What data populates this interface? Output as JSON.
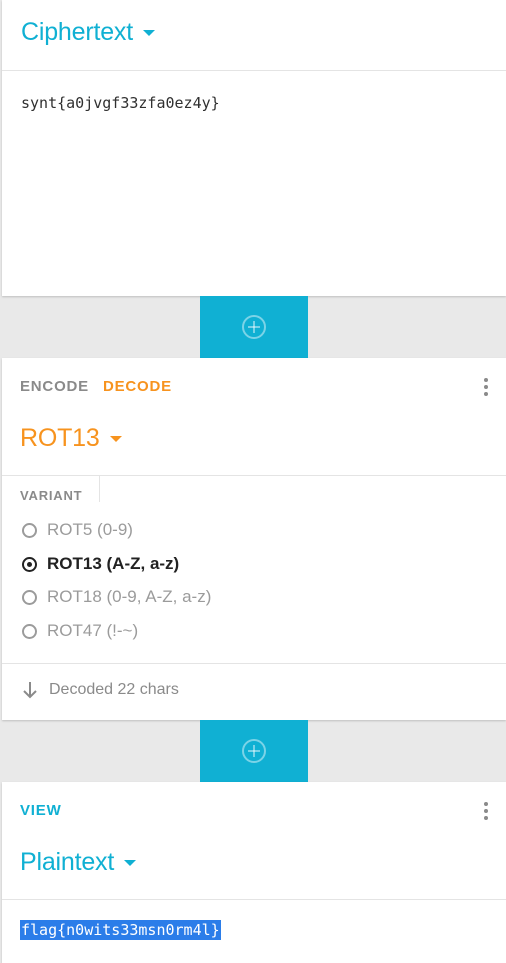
{
  "input": {
    "title": "Ciphertext",
    "value": "synt{a0jvgf33zfa0ez4y}"
  },
  "operation": {
    "tabs": [
      "ENCODE",
      "DECODE"
    ],
    "active_tab": "DECODE",
    "name": "ROT13",
    "variant_label": "VARIANT",
    "variants": [
      {
        "label": "ROT5 (0-9)",
        "checked": false
      },
      {
        "label": "ROT13 (A-Z, a-z)",
        "checked": true
      },
      {
        "label": "ROT18 (0-9, A-Z, a-z)",
        "checked": false
      },
      {
        "label": "ROT47 (!-~)",
        "checked": false
      }
    ],
    "status": "Decoded 22 chars"
  },
  "output": {
    "section_label": "VIEW",
    "title": "Plaintext",
    "value": "flag{n0wits33msn0rm4l}"
  },
  "colors": {
    "accent_blue": "#10b0d3",
    "accent_orange": "#f7931e",
    "selection": "#2b7de9"
  },
  "icons": {
    "add": "plus-circle-icon",
    "menu": "more-vertical-icon",
    "status": "arrow-down-icon",
    "dropdown": "caret-down-icon"
  }
}
